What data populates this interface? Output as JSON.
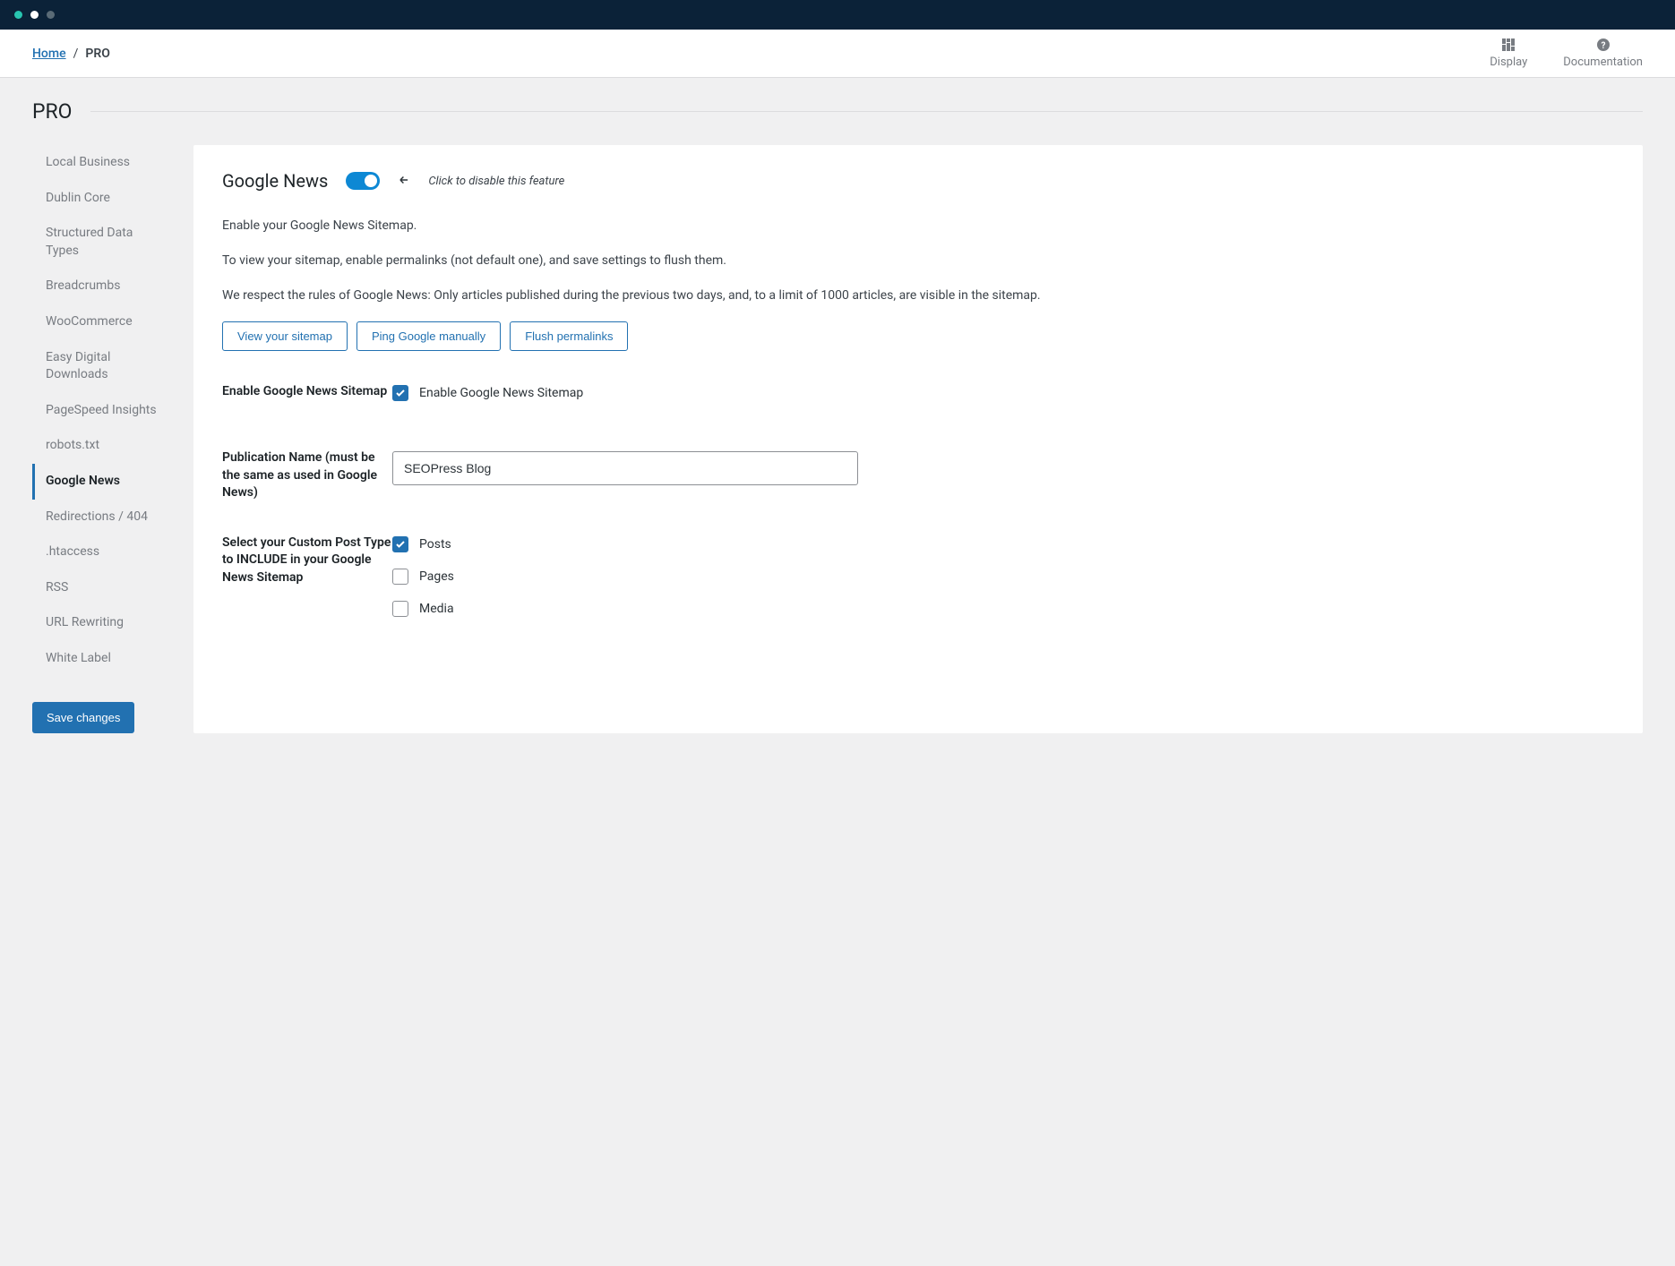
{
  "breadcrumb": {
    "home": "Home",
    "sep": "/",
    "current": "PRO"
  },
  "topbar": {
    "display": "Display",
    "documentation": "Documentation"
  },
  "page_title": "PRO",
  "sidebar": {
    "items": [
      {
        "label": "Local Business",
        "active": false
      },
      {
        "label": "Dublin Core",
        "active": false
      },
      {
        "label": "Structured Data Types",
        "active": false
      },
      {
        "label": "Breadcrumbs",
        "active": false
      },
      {
        "label": "WooCommerce",
        "active": false
      },
      {
        "label": "Easy Digital Downloads",
        "active": false
      },
      {
        "label": "PageSpeed Insights",
        "active": false
      },
      {
        "label": "robots.txt",
        "active": false
      },
      {
        "label": "Google News",
        "active": true
      },
      {
        "label": "Redirections / 404",
        "active": false
      },
      {
        "label": ".htaccess",
        "active": false
      },
      {
        "label": "RSS",
        "active": false
      },
      {
        "label": "URL Rewriting",
        "active": false
      },
      {
        "label": "White Label",
        "active": false
      }
    ],
    "save": "Save changes"
  },
  "panel": {
    "title": "Google News",
    "toggle_on": true,
    "hint": "Click to disable this feature",
    "desc1": "Enable your Google News Sitemap.",
    "desc2": "To view your sitemap, enable permalinks (not default one), and save settings to flush them.",
    "desc3": "We respect the rules of Google News: Only articles published during the previous two days, and, to a limit of 1000 articles, are visible in the sitemap.",
    "buttons": {
      "view_sitemap": "View your sitemap",
      "ping_google": "Ping Google manually",
      "flush": "Flush permalinks"
    },
    "field1": {
      "label": "Enable Google News Sitemap",
      "checkbox_label": "Enable Google News Sitemap",
      "checked": true
    },
    "field2": {
      "label": "Publication Name (must be the same as used in Google News)",
      "value": "SEOPress Blog"
    },
    "field3": {
      "label": "Select your Custom Post Type to INCLUDE in your Google News Sitemap",
      "options": [
        {
          "label": "Posts",
          "checked": true
        },
        {
          "label": "Pages",
          "checked": false
        },
        {
          "label": "Media",
          "checked": false
        }
      ]
    }
  }
}
